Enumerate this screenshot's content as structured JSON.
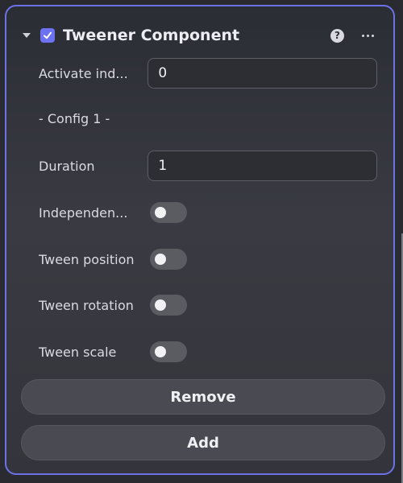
{
  "component": {
    "title": "Tweener Component",
    "enabled": true
  },
  "fields": {
    "activate_index": {
      "label": "Activate ind...",
      "value": "0"
    },
    "config_header": "- Config 1 -",
    "duration": {
      "label": "Duration",
      "value": "1"
    },
    "independent": {
      "label": "Independen...",
      "on": false
    },
    "tween_position": {
      "label": "Tween position",
      "on": false
    },
    "tween_rotation": {
      "label": "Tween rotation",
      "on": false
    },
    "tween_scale": {
      "label": "Tween scale",
      "on": false
    }
  },
  "buttons": {
    "remove": "Remove",
    "add": "Add"
  },
  "icons": {
    "collapse": "caret-down-icon",
    "check": "check-icon",
    "help": "help-icon",
    "more": "more-icon",
    "help_glyph": "?"
  },
  "colors": {
    "accent": "#6c72f0",
    "border": "#6b72e6"
  }
}
